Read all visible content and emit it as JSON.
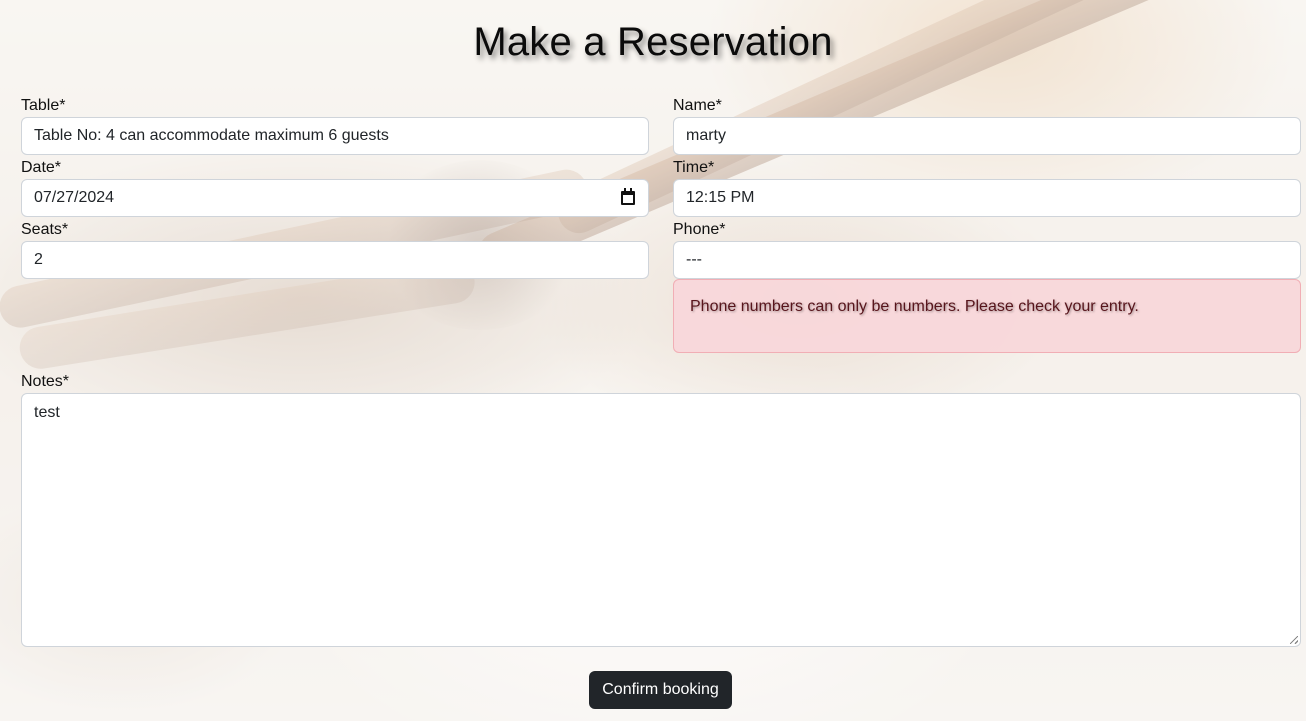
{
  "page": {
    "title": "Make a Reservation"
  },
  "form": {
    "table": {
      "label": "Table*",
      "value": "Table No: 4 can accommodate maximum 6 guests"
    },
    "name": {
      "label": "Name*",
      "value": "marty"
    },
    "date": {
      "label": "Date*",
      "value": "07/27/2024"
    },
    "time": {
      "label": "Time*",
      "value": "12:15 PM"
    },
    "seats": {
      "label": "Seats*",
      "value": "2"
    },
    "phone": {
      "label": "Phone*",
      "value": "---"
    },
    "phone_error": "Phone numbers can only be numbers. Please check your entry.",
    "notes": {
      "label": "Notes*",
      "value": "test"
    },
    "submit_label": "Confirm booking"
  },
  "icons": {
    "date_picker": "calendar-icon",
    "textarea_resize": "resize-grip-icon"
  },
  "colors": {
    "button_bg": "#212529",
    "alert_bg": "#f8d7da",
    "alert_text": "#58151c"
  }
}
